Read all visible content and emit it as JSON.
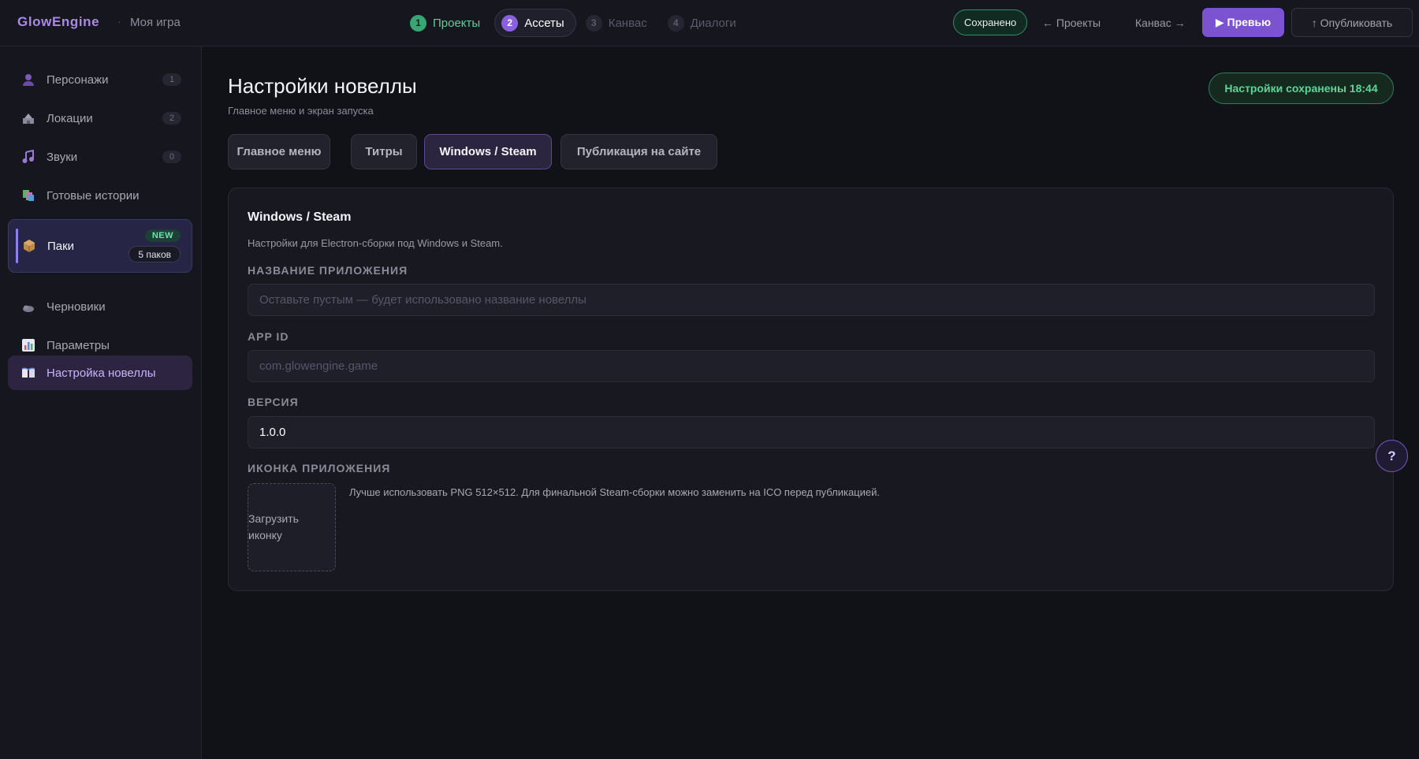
{
  "header": {
    "brand": "GlowEngine",
    "separator": "·",
    "project_name": "Моя игра",
    "steps": [
      {
        "num": "1",
        "label": "Проекты",
        "state": "done"
      },
      {
        "num": "2",
        "label": "Ассеты",
        "state": "active"
      },
      {
        "num": "3",
        "label": "Канвас",
        "state": "off"
      },
      {
        "num": "4",
        "label": "Диалоги",
        "state": "off"
      }
    ],
    "saved_label": "Сохранено",
    "prev_link": "← Проекты",
    "next_link": "Канвас →",
    "preview_label": "▶ Превью",
    "publish_label": "↑ Опубликовать"
  },
  "sidebar": {
    "items": [
      {
        "label": "Персонажи",
        "icon": "person-icon",
        "count": "1"
      },
      {
        "label": "Локации",
        "icon": "location-icon",
        "count": "2"
      },
      {
        "label": "Звуки",
        "icon": "music-note-icon",
        "count": "0"
      },
      {
        "label": "Готовые истории",
        "icon": "stories-icon"
      },
      {
        "label": "Паки",
        "icon": "package-icon",
        "badge_new": "NEW",
        "badge_count": "5 паков"
      },
      {
        "label": "Черновики",
        "icon": "drafts-icon"
      },
      {
        "label": "Параметры",
        "icon": "chart-icon"
      },
      {
        "label": "Настройка новеллы",
        "icon": "book-icon"
      }
    ]
  },
  "main": {
    "title": "Настройки новеллы",
    "subtitle": "Главное меню и экран запуска",
    "saved_status": "Настройки сохранены 18:44",
    "tabs": [
      {
        "label": "Главное меню"
      },
      {
        "label": "Титры"
      },
      {
        "label": "Windows / Steam"
      },
      {
        "label": "Публикация на сайте"
      }
    ],
    "panel": {
      "title": "Windows / Steam",
      "description": "Настройки для Electron-сборки под Windows и Steam.",
      "app_name": {
        "label": "НАЗВАНИЕ ПРИЛОЖЕНИЯ",
        "value": "",
        "placeholder": "Оставьте пустым — будет использовано название новеллы"
      },
      "app_id": {
        "label": "APP ID",
        "value": "",
        "placeholder": "com.glowengine.game"
      },
      "version": {
        "label": "ВЕРСИЯ",
        "value": "1.0.0",
        "placeholder": ""
      },
      "icon": {
        "label": "ИКОНКА ПРИЛОЖЕНИЯ",
        "upload_label": "Загрузить иконку",
        "hint": "Лучше использовать PNG 512×512. Для финальной Steam-сборки можно заменить на ICO перед публикацией."
      }
    }
  },
  "help": {
    "label": "?"
  },
  "colors": {
    "accent": "#7b52cf",
    "success": "#5ed49a",
    "background": "#111118"
  }
}
